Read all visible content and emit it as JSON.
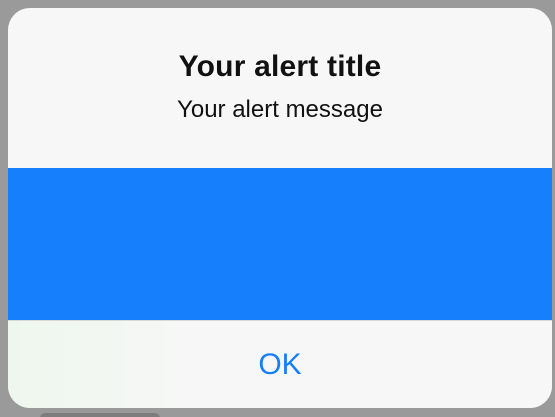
{
  "alert": {
    "title": "Your alert title",
    "message": "Your alert message",
    "button_label": "OK",
    "accent_color": "#167ffc",
    "background_color": "#f7f7f7"
  }
}
